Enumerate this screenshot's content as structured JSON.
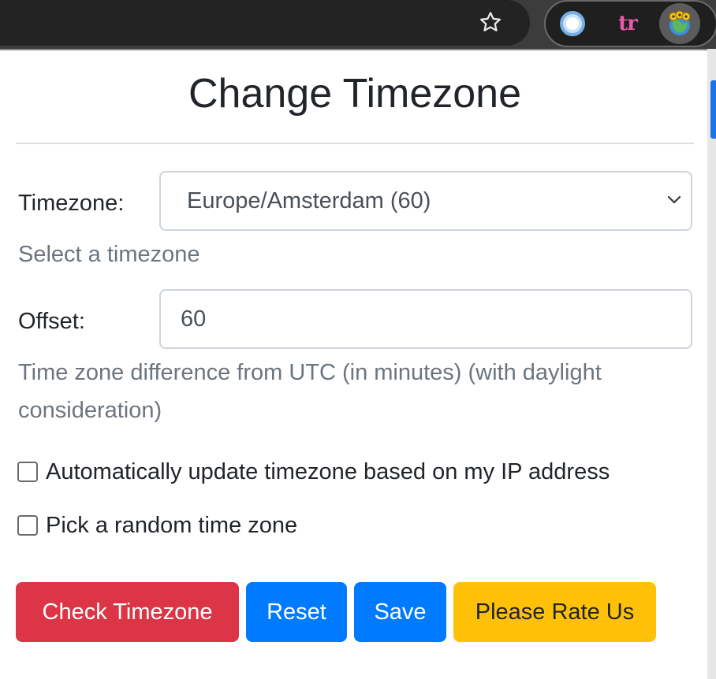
{
  "browser": {
    "bookmark_icon": "star-icon",
    "extensions": [
      {
        "icon": "ring-extension-icon"
      },
      {
        "icon": "tr-extension-icon",
        "text": "tr"
      },
      {
        "icon": "timezone-extension-icon"
      }
    ]
  },
  "popup": {
    "title": "Change Timezone",
    "timezone": {
      "label": "Timezone:",
      "selected": "Europe/Amsterdam (60)",
      "help": "Select a timezone"
    },
    "offset": {
      "label": "Offset:",
      "value": "60",
      "help": "Time zone difference from UTC (in minutes) (with daylight consideration)"
    },
    "options": [
      {
        "label": "Automatically update timezone based on my IP address",
        "checked": false
      },
      {
        "label": "Pick a random time zone",
        "checked": false
      }
    ],
    "buttons": {
      "check": "Check Timezone",
      "reset": "Reset",
      "save": "Save",
      "rate": "Please Rate Us"
    }
  },
  "colors": {
    "danger": "#dc3545",
    "primary": "#007bff",
    "warning": "#ffc107",
    "toolbar": "#3c3c3c"
  }
}
